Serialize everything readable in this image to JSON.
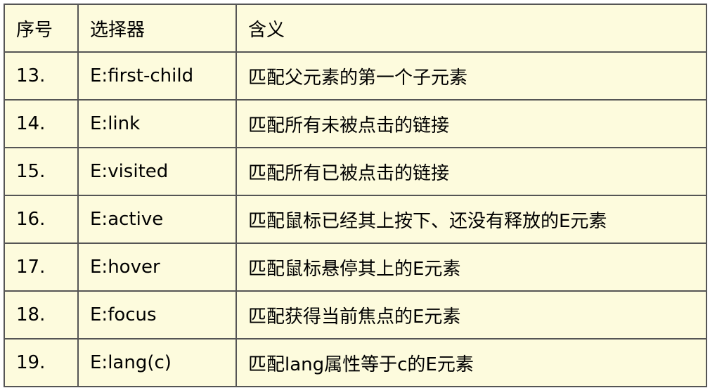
{
  "table": {
    "headers": [
      "序号",
      "选择器",
      "含义"
    ],
    "rows": [
      {
        "num": "13.",
        "selector": "E:first-child",
        "meaning": "匹配父元素的第一个子元素"
      },
      {
        "num": "14.",
        "selector": "E:link",
        "meaning": "匹配所有未被点击的链接"
      },
      {
        "num": "15.",
        "selector": "E:visited",
        "meaning": "匹配所有已被点击的链接"
      },
      {
        "num": "16.",
        "selector": "E:active",
        "meaning": "匹配鼠标已经其上按下、还没有释放的E元素"
      },
      {
        "num": "17.",
        "selector": "E:hover",
        "meaning": "匹配鼠标悬停其上的E元素"
      },
      {
        "num": "18.",
        "selector": "E:focus",
        "meaning": "匹配获得当前焦点的E元素"
      },
      {
        "num": "19.",
        "selector": "E:lang(c)",
        "meaning": "匹配lang属性等于c的E元素"
      }
    ],
    "colors": {
      "cell_background": "#fdfbdd",
      "border": "#555555",
      "text": "#000000"
    }
  }
}
